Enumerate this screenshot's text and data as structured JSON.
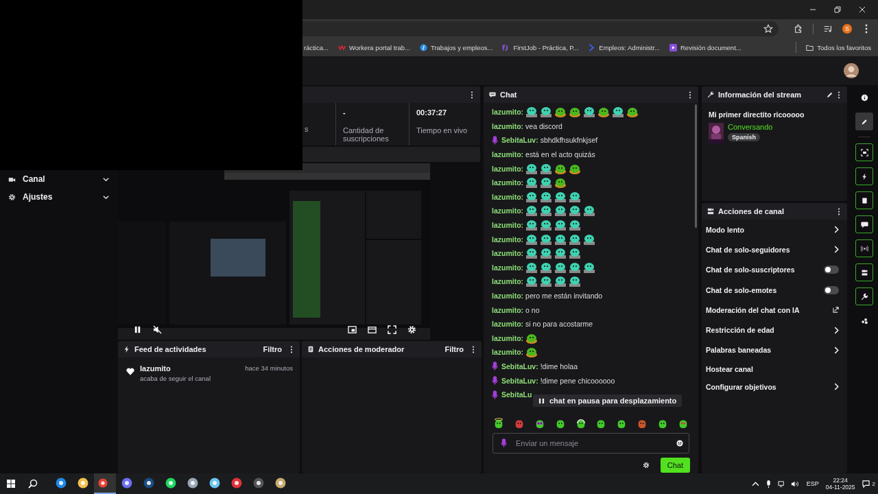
{
  "browser": {
    "profile_initial": "S",
    "bookmarks": [
      {
        "label": "ráctica..."
      },
      {
        "label": "Workera portal trab...",
        "kind": "workera"
      },
      {
        "label": "Trabajos y empleos...",
        "kind": "info"
      },
      {
        "label": "FirstJob - Práctica, P...",
        "kind": "firstjob"
      },
      {
        "label": "Empleos: Administr...",
        "kind": "chevron"
      },
      {
        "label": "Revisión document...",
        "kind": "play"
      }
    ],
    "all_bookmarks": "Todos los favoritos"
  },
  "sidebar": {
    "items": [
      {
        "label": "Canal",
        "kind": "camera",
        "expanded": false
      },
      {
        "label": "Ajustes",
        "kind": "gear",
        "expanded": false
      }
    ]
  },
  "stats_panel": {
    "stats": [
      {
        "label": "s"
      },
      {
        "value": "-",
        "label": "Cantidad de suscripciones"
      },
      {
        "value": "00:37:27",
        "label": "Tiempo en vivo"
      }
    ]
  },
  "video_player": {
    "kind": "picture",
    "playing": true,
    "muted": true
  },
  "activity_feed": {
    "title": "Feed de actividades",
    "filter": "Filtro",
    "events": [
      {
        "kind": "follow",
        "user": "lazumito",
        "time": "hace 34 minutos",
        "action": "acaba de seguir el canal"
      }
    ]
  },
  "moderator_actions": {
    "title": "Acciones de moderador",
    "filter": "Filtro"
  },
  "chat": {
    "title": "Chat",
    "messages": [
      {
        "user": "lazumito:",
        "badge": false,
        "emotes": [
          {
            "kind": "teal"
          },
          {
            "kind": "teal"
          },
          {
            "kind": "frog"
          },
          {
            "kind": "frog"
          },
          {
            "kind": "teal"
          },
          {
            "kind": "frog"
          },
          {
            "kind": "teal"
          },
          {
            "kind": "frog"
          }
        ]
      },
      {
        "user": "lazumito:",
        "badge": false,
        "text": "vea discord"
      },
      {
        "user": "SebitaLuv:",
        "badge": true,
        "text": "sbhdkfhsukfnkjsef"
      },
      {
        "user": "lazumito:",
        "badge": false,
        "text": "está en el acto quizás"
      },
      {
        "user": "lazumito:",
        "badge": false,
        "emotes": [
          {
            "kind": "teal"
          },
          {
            "kind": "teal"
          },
          {
            "kind": "frog"
          },
          {
            "kind": "frog"
          }
        ]
      },
      {
        "user": "lazumito:",
        "badge": false,
        "emotes": [
          {
            "kind": "teal"
          },
          {
            "kind": "teal"
          },
          {
            "kind": "frog"
          }
        ]
      },
      {
        "user": "lazumito:",
        "badge": false,
        "emotes": [
          {
            "kind": "teal"
          },
          {
            "kind": "teal"
          },
          {
            "kind": "teal"
          },
          {
            "kind": "teal"
          }
        ]
      },
      {
        "user": "lazumito:",
        "badge": false,
        "emotes": [
          {
            "kind": "teal"
          },
          {
            "kind": "teal"
          },
          {
            "kind": "teal"
          },
          {
            "kind": "teal"
          },
          {
            "kind": "teal"
          }
        ]
      },
      {
        "user": "lazumito:",
        "badge": false,
        "emotes": [
          {
            "kind": "teal"
          },
          {
            "kind": "teal"
          },
          {
            "kind": "teal"
          },
          {
            "kind": "teal"
          }
        ]
      },
      {
        "user": "lazumito:",
        "badge": false,
        "emotes": [
          {
            "kind": "teal"
          },
          {
            "kind": "teal"
          },
          {
            "kind": "teal"
          },
          {
            "kind": "teal"
          },
          {
            "kind": "teal"
          }
        ]
      },
      {
        "user": "lazumito:",
        "badge": false,
        "emotes": [
          {
            "kind": "teal"
          },
          {
            "kind": "teal"
          },
          {
            "kind": "teal"
          },
          {
            "kind": "teal"
          }
        ]
      },
      {
        "user": "lazumito:",
        "badge": false,
        "emotes": [
          {
            "kind": "teal"
          },
          {
            "kind": "teal"
          },
          {
            "kind": "teal"
          },
          {
            "kind": "teal"
          },
          {
            "kind": "teal"
          }
        ]
      },
      {
        "user": "lazumito:",
        "badge": false,
        "emotes": [
          {
            "kind": "teal"
          },
          {
            "kind": "teal"
          },
          {
            "kind": "teal"
          },
          {
            "kind": "teal"
          }
        ]
      },
      {
        "user": "lazumito:",
        "badge": false,
        "text": "pero me están invitando"
      },
      {
        "user": "lazumito:",
        "badge": false,
        "text": "o no"
      },
      {
        "user": "lazumito:",
        "badge": false,
        "text": "si no para acostarme"
      },
      {
        "user": "lazumito:",
        "badge": false,
        "emotes": [
          {
            "kind": "frog"
          }
        ]
      },
      {
        "user": "lazumito:",
        "badge": false,
        "emotes": [
          {
            "kind": "frog"
          }
        ]
      },
      {
        "user": "SebitaLuv:",
        "badge": true,
        "text": "!dime holaa"
      },
      {
        "user": "SebitaLuv:",
        "badge": true,
        "text": "!dime pene chicoooooo"
      },
      {
        "user": "SebitaLu",
        "badge": true
      }
    ],
    "pause_notice": "chat en pausa para desplazamiento",
    "emote_bar": [
      {
        "kind": "halo"
      },
      {
        "kind": "red"
      },
      {
        "kind": "glasses"
      },
      {
        "kind": "grin"
      },
      {
        "kind": "headset"
      },
      {
        "kind": "blob"
      },
      {
        "kind": "blob"
      },
      {
        "kind": "burger"
      },
      {
        "kind": "sad"
      },
      {
        "kind": "love"
      }
    ],
    "input": {
      "placeholder": "Enviar un mensaje"
    },
    "send_button": "Chat"
  },
  "stream_info": {
    "title": "Información del stream",
    "stream_title": "Mi primer directito ricooooo",
    "category": "Conversando",
    "tags": [
      "Spanish"
    ]
  },
  "channel_actions": {
    "title": "Acciones de canal",
    "items": [
      {
        "label": "Modo lento",
        "kind": "submenu"
      },
      {
        "label": "Chat de solo-seguidores",
        "kind": "submenu"
      },
      {
        "label": "Chat de solo-suscriptores",
        "kind": "toggle",
        "on": false
      },
      {
        "label": "Chat de solo-emotes",
        "kind": "toggle",
        "on": false
      },
      {
        "label": "Moderación del chat con IA",
        "kind": "external"
      },
      {
        "label": "Restricción de edad",
        "kind": "submenu"
      },
      {
        "label": "Palabras baneadas",
        "kind": "submenu"
      },
      {
        "label": "Hostear canal",
        "kind": "plain"
      },
      {
        "label": "Configurar objetivos",
        "kind": "submenu"
      }
    ]
  },
  "tool_rail": [
    {
      "kind": "info",
      "selected": false,
      "pinned": false
    },
    {
      "kind": "edit",
      "selected": true,
      "pinned": false
    },
    {
      "kind": "capture",
      "selected": false,
      "pinned": true
    },
    {
      "kind": "bolt",
      "selected": false,
      "pinned": true
    },
    {
      "kind": "notes",
      "selected": false,
      "pinned": true
    },
    {
      "kind": "chat",
      "selected": false,
      "pinned": true
    },
    {
      "kind": "broadcast",
      "selected": false,
      "pinned": true
    },
    {
      "kind": "channel",
      "selected": false,
      "pinned": true
    },
    {
      "kind": "wrench",
      "selected": false,
      "pinned": true
    },
    {
      "kind": "dots",
      "selected": false,
      "pinned": false
    }
  ],
  "taskbar": {
    "apps": [
      {
        "kind": "mail",
        "active": false
      },
      {
        "kind": "folder",
        "active": false
      },
      {
        "kind": "browser",
        "active": true
      },
      {
        "kind": "discord",
        "active": false
      },
      {
        "kind": "steam",
        "active": false
      },
      {
        "kind": "music",
        "active": false
      },
      {
        "kind": "game",
        "active": false
      },
      {
        "kind": "tool",
        "active": false
      },
      {
        "kind": "red",
        "active": false
      },
      {
        "kind": "obs",
        "active": false
      },
      {
        "kind": "league",
        "active": false
      }
    ],
    "language": "ESP",
    "time": "22:24",
    "date": "04-11-2025",
    "notifications": "2"
  }
}
